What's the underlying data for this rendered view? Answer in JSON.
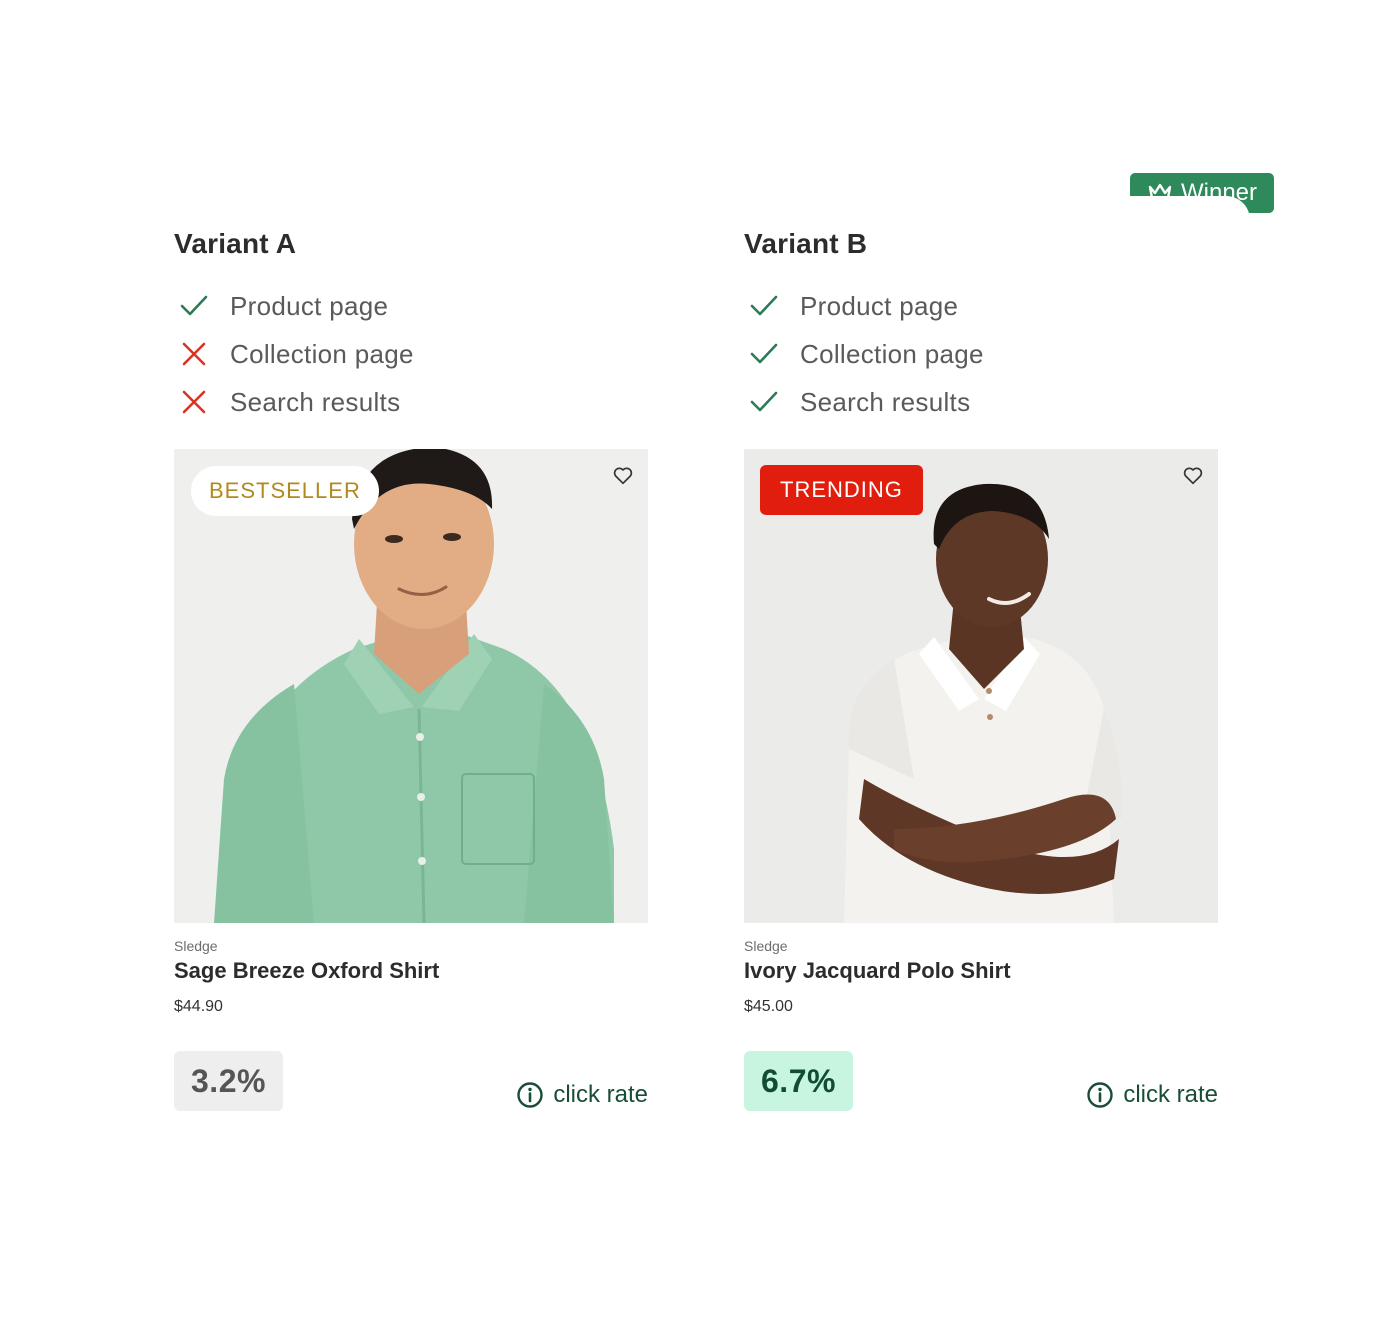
{
  "winner_badge": {
    "label": "Winner",
    "icon": "crown-icon"
  },
  "variants": [
    {
      "title": "Variant A",
      "placements": [
        {
          "label": "Product page",
          "included": true
        },
        {
          "label": "Collection page",
          "included": false
        },
        {
          "label": "Search results",
          "included": false
        }
      ],
      "badge": "BESTSELLER",
      "vendor": "Sledge",
      "product_name": "Sage Breeze Oxford Shirt",
      "price": "$44.90",
      "click_rate": "3.2%",
      "metric_label": "click rate"
    },
    {
      "title": "Variant B",
      "placements": [
        {
          "label": "Product page",
          "included": true
        },
        {
          "label": "Collection page",
          "included": true
        },
        {
          "label": "Search results",
          "included": true
        }
      ],
      "badge": "TRENDING",
      "vendor": "Sledge",
      "product_name": "Ivory Jacquard Polo Shirt",
      "price": "$45.00",
      "click_rate": "6.7%",
      "metric_label": "click rate"
    }
  ],
  "colors": {
    "check": "#2e7a55",
    "cross": "#d9331f",
    "winner": "#2e8a5b",
    "bestseller_text": "#b08a1e",
    "trending_bg": "#e11e0e",
    "rate_winner_bg": "#c8f5df"
  }
}
